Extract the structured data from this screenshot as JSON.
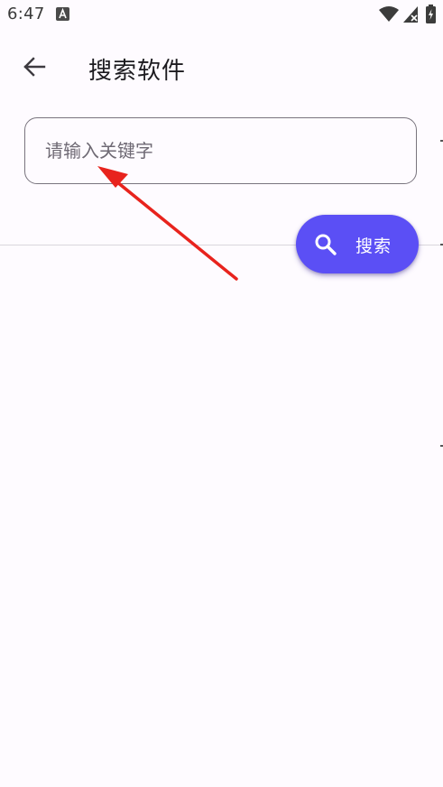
{
  "status_bar": {
    "time": "6:47",
    "notification_icon": "a-letter-icon",
    "wifi_icon": "wifi-icon",
    "signal_icon": "signal-no-service-icon",
    "battery_icon": "battery-charging-icon"
  },
  "app_bar": {
    "back_icon": "arrow-back-icon",
    "title": "搜索软件"
  },
  "search": {
    "placeholder": "请输入关键字",
    "value": ""
  },
  "fab": {
    "icon": "search-icon",
    "label": "搜索",
    "color": "#5b4ff5"
  },
  "annotation": {
    "arrow_color": "#e8231d"
  }
}
